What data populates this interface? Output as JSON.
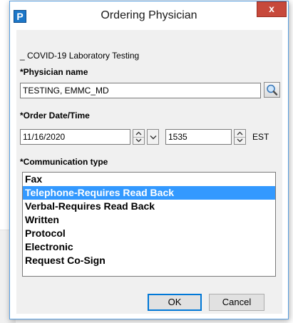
{
  "window": {
    "title": "Ordering Physician",
    "app_icon_letter": "P",
    "close_glyph": "x"
  },
  "form": {
    "order_label": "_ COVID-19 Laboratory Testing",
    "physician": {
      "label": "*Physician name",
      "value": "TESTING, EMMC_MD"
    },
    "order_datetime": {
      "label": "*Order Date/Time",
      "date": "11/16/2020",
      "time": "1535",
      "timezone": "EST"
    },
    "communication": {
      "label": "*Communication type",
      "options": [
        "Fax",
        "Telephone-Requires Read Back",
        "Verbal-Requires Read Back",
        "Written",
        "Protocol",
        "Electronic",
        "Request Co-Sign"
      ],
      "selected": "Telephone-Requires Read Back"
    }
  },
  "buttons": {
    "ok": "OK",
    "cancel": "Cancel"
  },
  "icons": {
    "search": "magnifier-icon",
    "spin_up": "chevron-up-icon",
    "spin_down": "chevron-down-icon",
    "dropdown": "chevron-down-icon"
  },
  "colors": {
    "selection": "#3399ff",
    "close": "#c7493b",
    "window_border": "#5a9fe0"
  }
}
